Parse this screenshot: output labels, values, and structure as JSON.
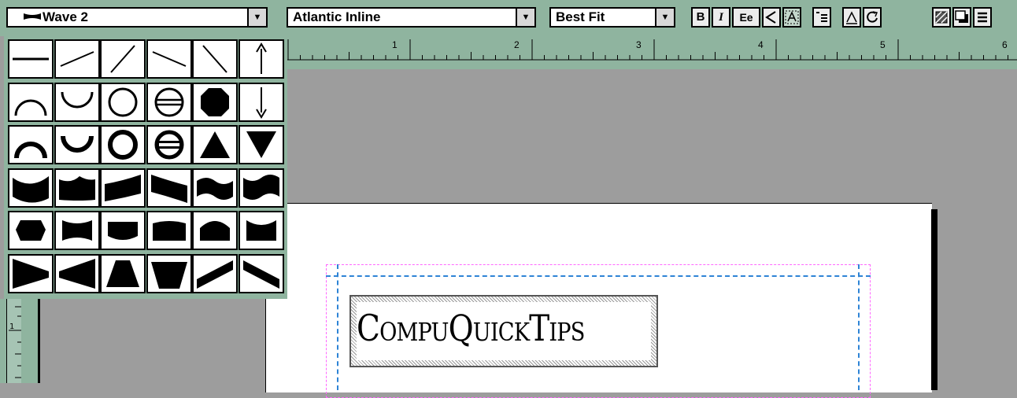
{
  "toolbar": {
    "shape_value": "Wave 2",
    "font_value": "Atlantic Inline",
    "size_value": "Best Fit",
    "bold_label": "B",
    "italic_label": "I",
    "case_label": "Ee",
    "dropdown_glyph": "▼",
    "ruler_numbers": [
      "1",
      "2",
      "3",
      "4",
      "5",
      "6"
    ]
  },
  "palette": {
    "shapes": [
      [
        "line-horizontal",
        "line-rising-shallow",
        "line-rising-steep",
        "line-falling-shallow",
        "line-falling-steep",
        "arrow-up"
      ],
      [
        "arc-top",
        "arc-bottom",
        "circle",
        "circle-split",
        "octagon-filled",
        "arrow-down"
      ],
      [
        "arc-top-thick",
        "arc-bottom-thick",
        "circle-thick",
        "circle-split-thick",
        "triangle-up",
        "triangle-down"
      ],
      [
        "wave-1",
        "wave-2",
        "wave-3",
        "wave-4",
        "wave-5",
        "wave-6"
      ],
      [
        "blob-1",
        "blob-2",
        "blob-3",
        "blob-4",
        "blob-5",
        "blob-6"
      ],
      [
        "wedge-right",
        "wedge-left",
        "trapezoid",
        "trapezoid-inverted",
        "slant-up",
        "slant-down"
      ]
    ]
  },
  "document": {
    "logo_text": "CompuQuickTips"
  },
  "colors": {
    "toolbar_bg": "#8fb49f",
    "workspace_bg": "#9d9d9d",
    "margin_guide": "#ff66ff",
    "column_guide": "#2e84d6"
  }
}
